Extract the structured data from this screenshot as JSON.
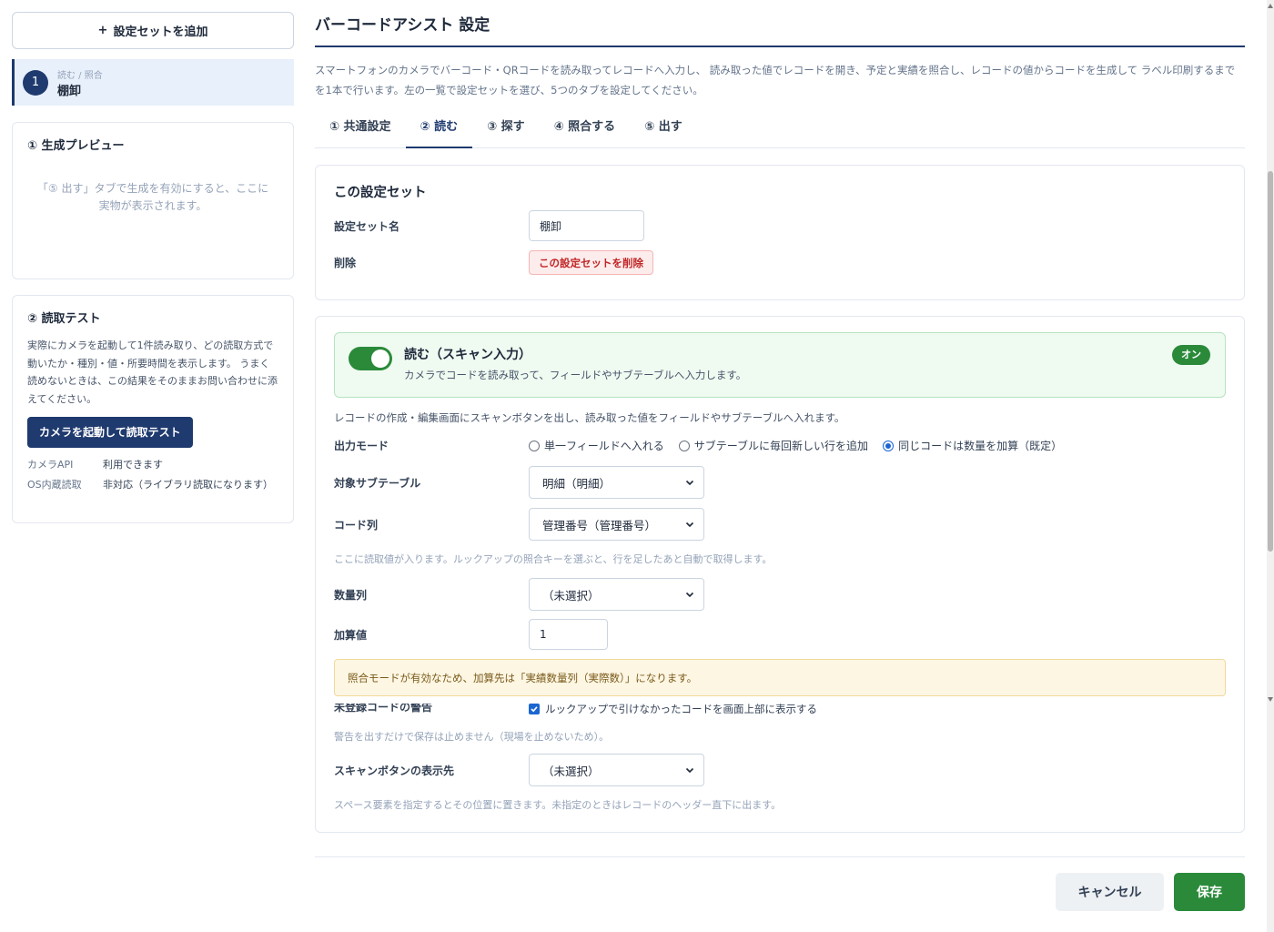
{
  "sidebar": {
    "add_button": "設定セットを追加",
    "add_icon": "+",
    "set_item": {
      "number": "1",
      "sub": "読む / 照合",
      "name": "棚卸"
    },
    "preview": {
      "title": "① 生成プレビュー",
      "note_line1": "「⑤ 出す」タブで生成を有効にすると、ここに",
      "note_line2": "実物が表示されます。"
    },
    "test": {
      "title": "② 読取テスト",
      "desc": "実際にカメラを起動して1件読み取り、どの読取方式で動いたか・種別・値・所要時間を表示します。 うまく読めないときは、この結果をそのままお問い合わせに添えてください。",
      "button": "カメラを起動して読取テスト",
      "rows": [
        {
          "key": "カメラAPI",
          "value": "利用できます"
        },
        {
          "key": "OS内蔵読取",
          "value": "非対応（ライブラリ読取になります）"
        }
      ]
    }
  },
  "main": {
    "title": "バーコードアシスト 設定",
    "intro": "スマートフォンのカメラでバーコード・QRコードを読み取ってレコードへ入力し、 読み取った値でレコードを開き、予定と実績を照合し、レコードの値からコードを生成して ラベル印刷するまでを1本で行います。左の一覧で設定セットを選び、5つのタブを設定してください。",
    "tabs": [
      "① 共通設定",
      "② 読む",
      "③ 探す",
      "④ 照合する",
      "⑤ 出す"
    ],
    "active_tab": "② 読む",
    "set_section": {
      "title": "この設定セット",
      "name_label": "設定セット名",
      "name_value": "棚卸",
      "delete_label": "削除",
      "delete_button": "この設定セットを削除"
    },
    "read_section": {
      "banner_title": "読む（スキャン入力）",
      "banner_desc": "カメラでコードを読み取って、フィールドやサブテーブルへ入力します。",
      "badge": "オン",
      "toggle_on": true,
      "desc": "レコードの作成・編集画面にスキャンボタンを出し、読み取った値をフィールドやサブテーブルへ入れます。",
      "output_mode_label": "出力モード",
      "output_modes": [
        "単一フィールドへ入れる",
        "サブテーブルに毎回新しい行を追加",
        "同じコードは数量を加算（既定）"
      ],
      "output_mode_selected": "同じコードは数量を加算（既定）",
      "subtable_label": "対象サブテーブル",
      "subtable_value": "明細（明細）",
      "code_col_label": "コード列",
      "code_col_value": "管理番号（管理番号）",
      "code_col_hint": "ここに読取値が入ります。ルックアップの照合キーを選ぶと、行を足したあと自動で取得します。",
      "qty_col_label": "数量列",
      "qty_col_value": "（未選択）",
      "add_value_label": "加算値",
      "add_value": "1",
      "alert": "照合モードが有効なため、加算先は「実績数量列（実際数）」になります。",
      "unregistered_label": "未登録コードの警告",
      "unregistered_checkbox": "ルックアップで引けなかったコードを画面上部に表示する",
      "unregistered_hint": "警告を出すだけで保存は止めません（現場を止めないため）。",
      "scan_btn_label": "スキャンボタンの表示先",
      "scan_btn_value": "（未選択）",
      "scan_btn_hint": "スペース要素を指定するとその位置に置きます。未指定のときはレコードのヘッダー直下に出ます。"
    }
  },
  "footer": {
    "cancel": "キャンセル",
    "save": "保存"
  },
  "colors": {
    "accent": "#1e3a6e",
    "success": "#2a8a3a",
    "danger": "#c02626"
  }
}
